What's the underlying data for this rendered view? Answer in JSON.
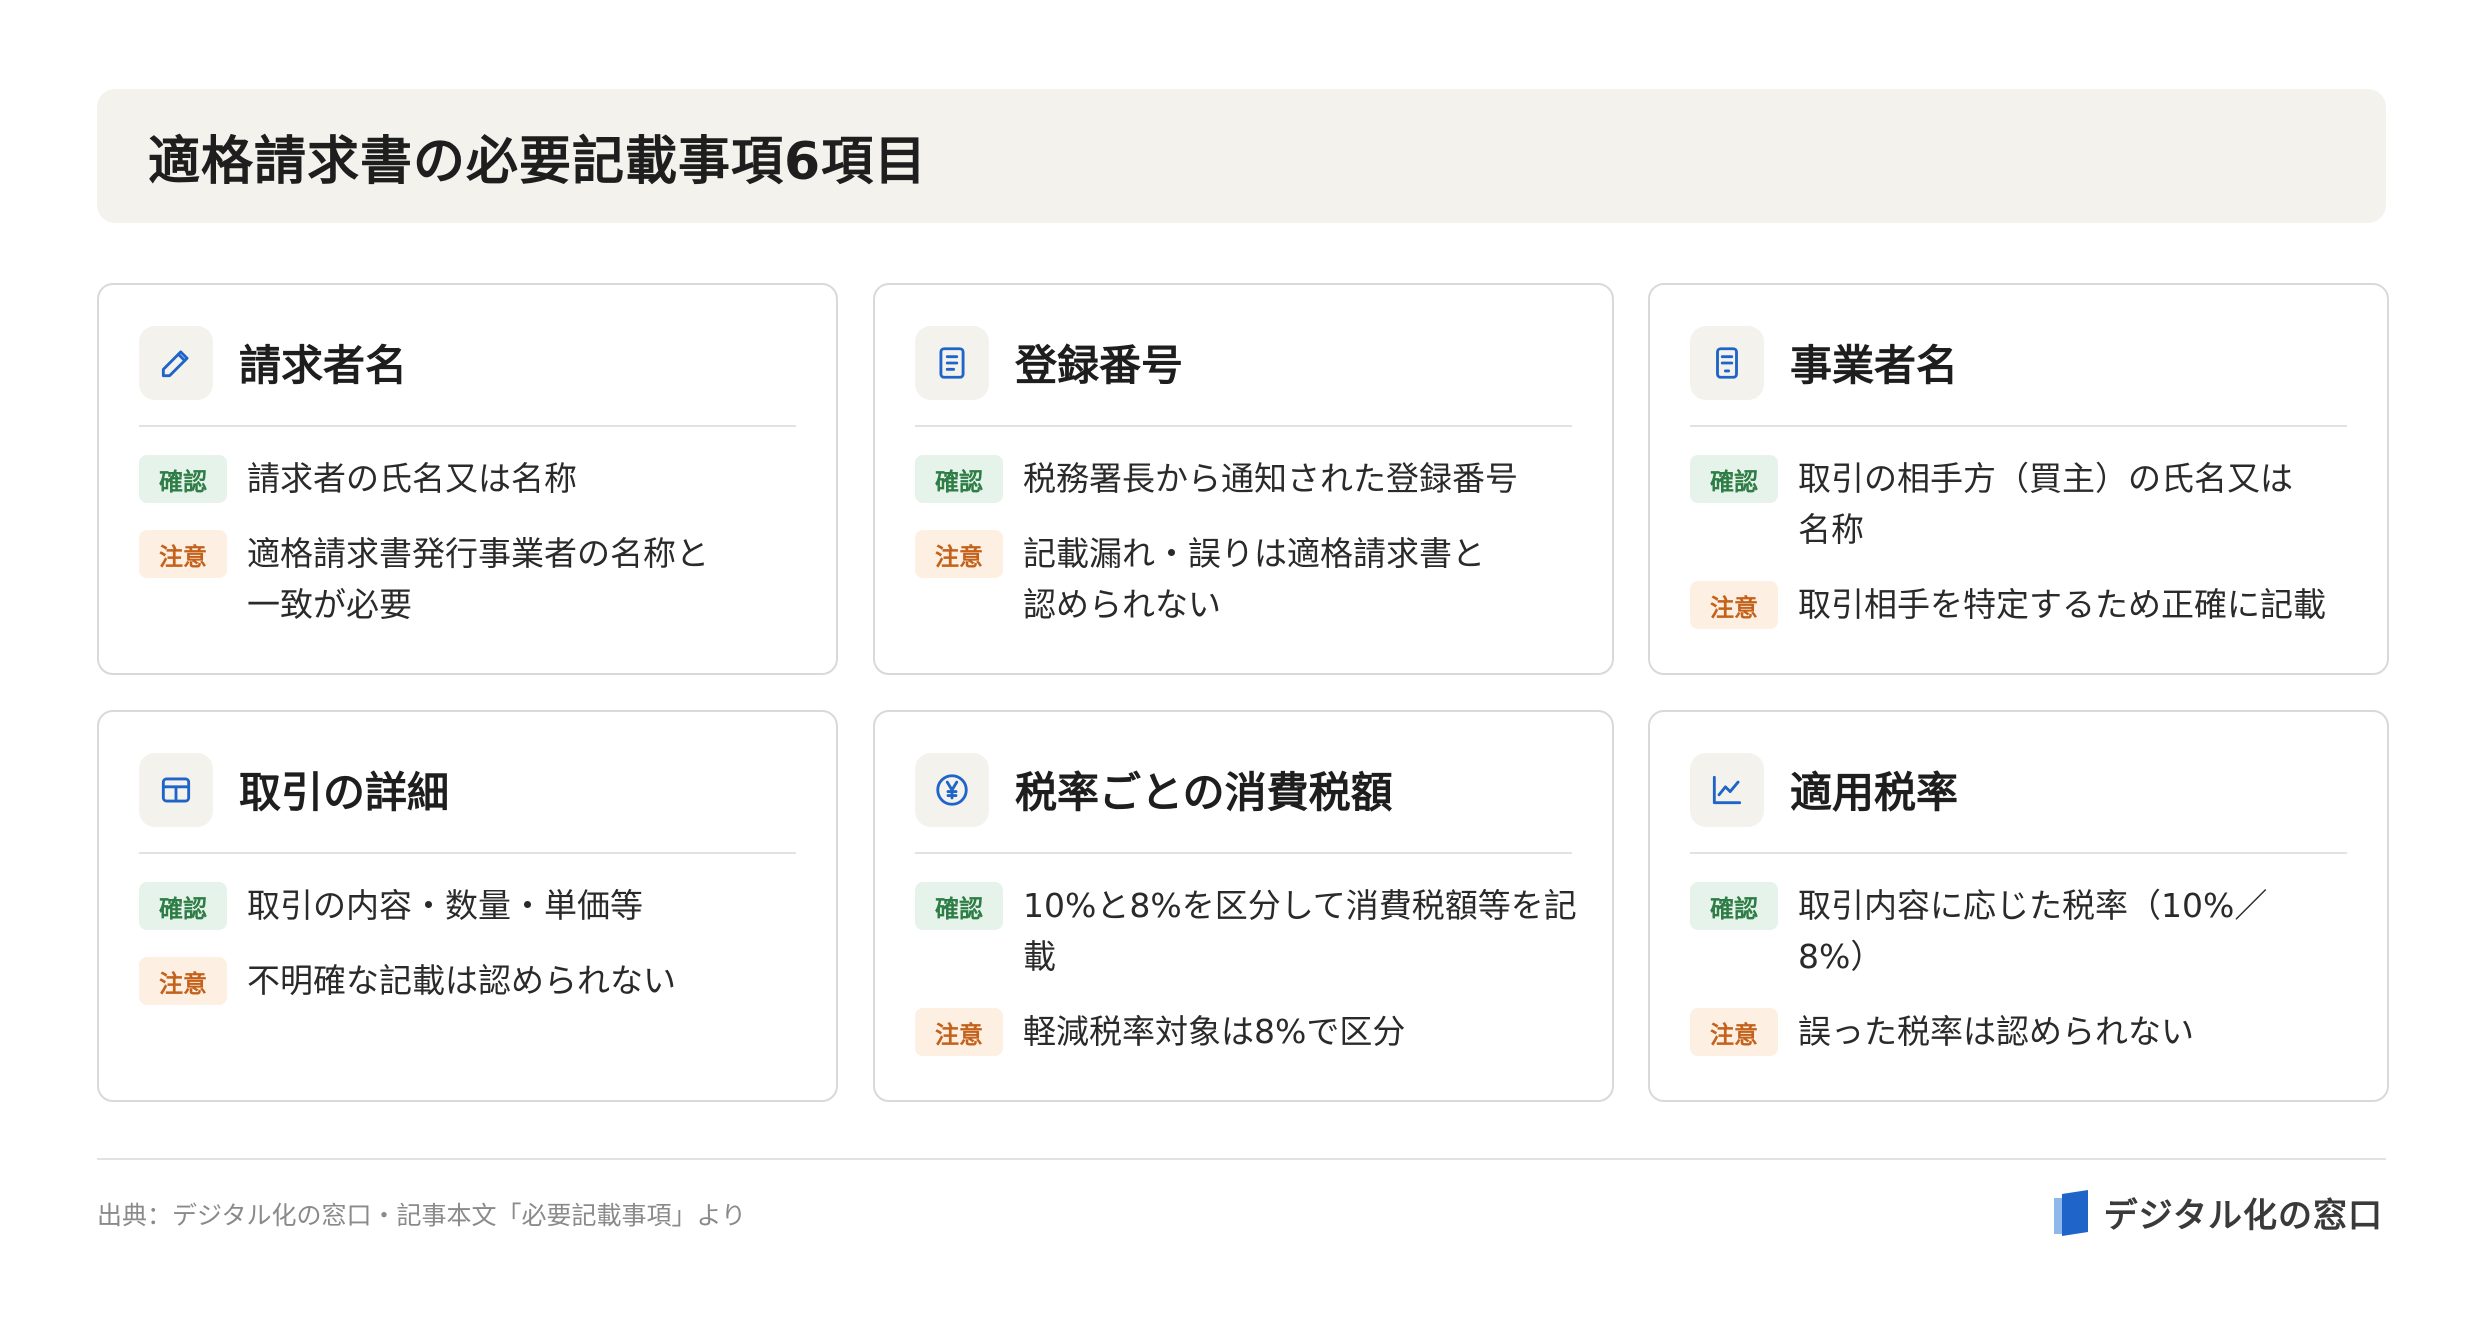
{
  "title": "適格請求書の必要記載事項6項目",
  "cards": [
    {
      "icon": "pencil-icon",
      "title": "請求者名",
      "confirm_label": "確認",
      "confirm_text": "請求者の氏名又は名称",
      "note_label": "注意",
      "note_text": "適格請求書発行事業者の名称と一致が必要"
    },
    {
      "icon": "document-icon",
      "title": "登録番号",
      "confirm_label": "確認",
      "confirm_text": "税務署長から通知された登録番号",
      "note_label": "注意",
      "note_text": "記載漏れ・誤りは適格請求書と認められない"
    },
    {
      "icon": "receipt-icon",
      "title": "事業者名",
      "confirm_label": "確認",
      "confirm_text": "取引の相手方（買主）の氏名又は名称",
      "note_label": "注意",
      "note_text": "取引相手を特定するため正確に記載"
    },
    {
      "icon": "table-icon",
      "title": "取引の詳細",
      "confirm_label": "確認",
      "confirm_text": "取引の内容・数量・単価等",
      "note_label": "注意",
      "note_text": "不明確な記載は認められない"
    },
    {
      "icon": "yen-icon",
      "title": "税率ごとの消費税額",
      "confirm_label": "確認",
      "confirm_text": "10%と8%を区分して消費税額等を記載",
      "note_label": "注意",
      "note_text": "軽減税率対象は8%で区分"
    },
    {
      "icon": "chart-icon",
      "title": "適用税率",
      "confirm_label": "確認",
      "confirm_text": "取引内容に応じた税率（10%／8%）",
      "note_label": "注意",
      "note_text": "誤った税率は認められない"
    }
  ],
  "footer": {
    "source": "出典：デジタル化の窓口・記事本文「必要記載事項」より",
    "brand": "デジタル化の窓口"
  },
  "colors": {
    "accent_blue": "#1f64c8",
    "confirm_bg": "#e6f3ea",
    "confirm_text": "#2e7d46",
    "note_bg": "#fdf0e2",
    "note_text": "#c4621c",
    "title_bg": "#f4f2ec"
  }
}
